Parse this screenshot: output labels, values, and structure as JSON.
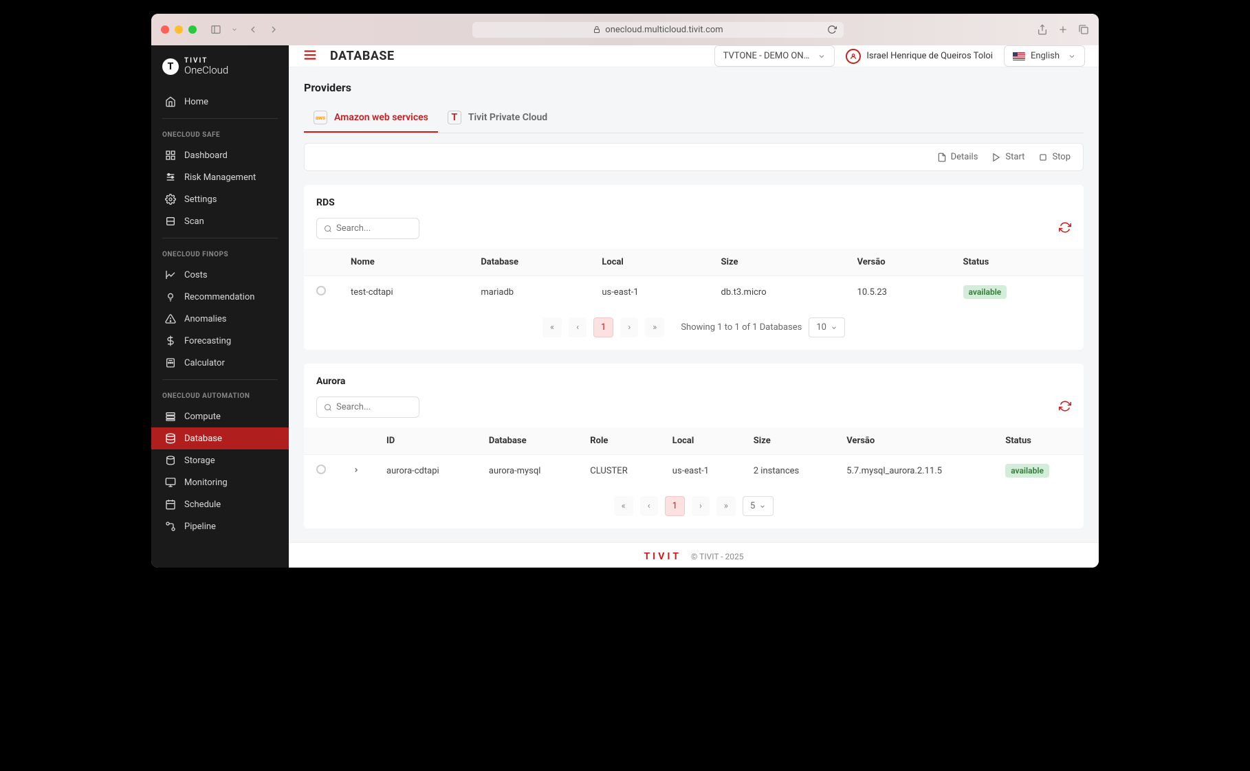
{
  "browser": {
    "url": "onecloud.multicloud.tivit.com"
  },
  "logo": {
    "brand": "TIVIT",
    "product": "OneCloud"
  },
  "sidebar": {
    "home": "Home",
    "sections": [
      {
        "title": "ONECLOUD SAFE",
        "items": [
          "Dashboard",
          "Risk Management",
          "Settings",
          "Scan"
        ]
      },
      {
        "title": "ONECLOUD FINOPS",
        "items": [
          "Costs",
          "Recommendation",
          "Anomalies",
          "Forecasting",
          "Calculator"
        ]
      },
      {
        "title": "ONECLOUD AUTOMATION",
        "items": [
          "Compute",
          "Database",
          "Storage",
          "Monitoring",
          "Schedule",
          "Pipeline"
        ]
      }
    ],
    "active": "Database"
  },
  "header": {
    "title": "DATABASE",
    "org": "TVTONE - DEMO ON…",
    "user": "Israel Henrique de Queiros Toloi",
    "language": "English"
  },
  "providers": {
    "label": "Providers",
    "tabs": [
      {
        "label": "Amazon web services",
        "icon": "aws",
        "active": true
      },
      {
        "label": "Tivit Private Cloud",
        "icon": "T",
        "active": false
      }
    ]
  },
  "toolbar": {
    "details": "Details",
    "start": "Start",
    "stop": "Stop"
  },
  "rds": {
    "title": "RDS",
    "search_placeholder": "Search...",
    "columns": [
      "Nome",
      "Database",
      "Local",
      "Size",
      "Versão",
      "Status"
    ],
    "rows": [
      {
        "nome": "test-cdtapi",
        "database": "mariadb",
        "local": "us-east-1",
        "size": "db.t3.micro",
        "versao": "10.5.23",
        "status": "available"
      }
    ],
    "pager": {
      "current": "1",
      "text": "Showing 1 to 1 of 1 Databases",
      "page_size": "10"
    }
  },
  "aurora": {
    "title": "Aurora",
    "search_placeholder": "Search...",
    "columns": [
      "ID",
      "Database",
      "Role",
      "Local",
      "Size",
      "Versão",
      "Status"
    ],
    "rows": [
      {
        "id": "aurora-cdtapi",
        "database": "aurora-mysql",
        "role": "CLUSTER",
        "local": "us-east-1",
        "size": "2 instances",
        "versao": "5.7.mysql_aurora.2.11.5",
        "status": "available"
      }
    ],
    "pager": {
      "current": "1",
      "page_size": "5"
    }
  },
  "footer": {
    "logo": "TIVIT",
    "text": "© TIVIT - 2025"
  }
}
